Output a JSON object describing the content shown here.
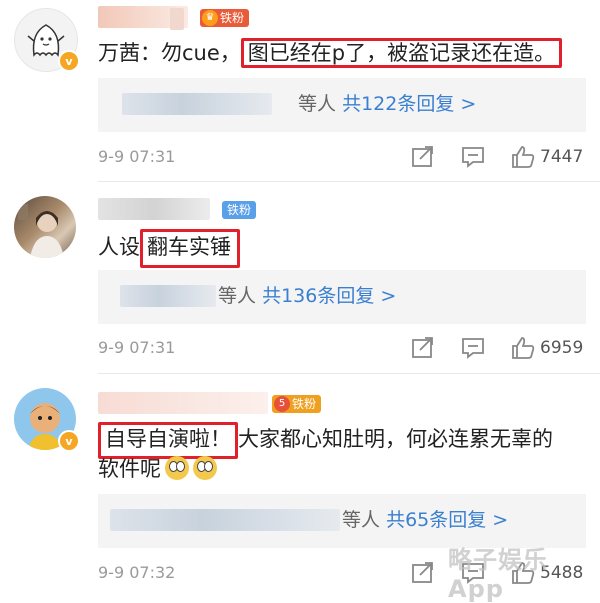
{
  "comments": [
    {
      "badge_text": "铁粉",
      "text_prefix": "万茜：勿cue，",
      "text_highlight": "图已经在p了，被盗记录还在造。",
      "text_suffix": "",
      "replies_who": "等人",
      "replies_count": "共122条回复 >",
      "time": "9-9 07:31",
      "likes": "7447"
    },
    {
      "badge_text": "铁粉",
      "text_prefix": "人设",
      "text_highlight": "翻车实锤",
      "text_suffix": "",
      "replies_who": "等人",
      "replies_count": "共136条回复 >",
      "time": "9-9 07:31",
      "likes": "6959"
    },
    {
      "badge_text": "铁粉",
      "badge_level": "5",
      "text_prefix": "",
      "text_highlight": "自导自演啦！",
      "text_suffix": "大家都心知肚明，何必连累无辜的",
      "text_line2": "软件呢",
      "replies_who": "等人",
      "replies_count": "共65条回复 >",
      "time": "9-9 07:32",
      "likes": "5488"
    }
  ],
  "watermark": "略子娱乐App",
  "colors": {
    "link": "#3a7fd0",
    "highlight_box": "#e0202a",
    "badge": "#5aa0e8",
    "vip": "#f5a623"
  },
  "icons": [
    "share-icon",
    "comment-icon",
    "like-icon",
    "vip-badge-icon",
    "crown-icon"
  ]
}
